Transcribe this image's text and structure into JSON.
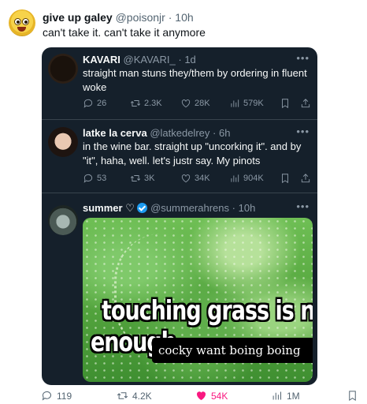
{
  "main_tweet": {
    "display_name": "give up galey",
    "handle": "@poisonjr",
    "separator": "·",
    "time": "10h",
    "text": "can't take it. can't take it anymore"
  },
  "quoted": [
    {
      "display_name": "KAVARI",
      "handle": "@KAVARI_",
      "separator": "·",
      "time": "1d",
      "text": "straight man stuns they/them by ordering in fluent woke",
      "replies": "26",
      "retweets": "2.3K",
      "likes": "28K",
      "views": "579K"
    },
    {
      "display_name": "latke la cerva",
      "handle": "@latkedelrey",
      "separator": "·",
      "time": "6h",
      "text": "in the wine bar. straight up \"uncorking it\". and by \"it\", haha, well. let's justr say. My pinots",
      "replies": "53",
      "retweets": "3K",
      "likes": "34K",
      "views": "904K"
    },
    {
      "display_name": "summer",
      "handle": "@summerahrens",
      "separator": "·",
      "time": "10h",
      "meme_line1": "touching grass is not",
      "meme_line2": "enough",
      "meme_caption": "cocky want boing boing"
    }
  ],
  "main_actions": {
    "replies": "119",
    "retweets": "4.2K",
    "likes": "54K",
    "views": "1M"
  },
  "icons": {
    "reply": "reply-icon",
    "retweet": "retweet-icon",
    "like": "heart-icon",
    "views": "views-icon",
    "bookmark": "bookmark-icon",
    "share": "share-icon"
  },
  "colors": {
    "card_bg": "#15202b",
    "like_active": "#f91880",
    "verified": "#1d9bf0"
  }
}
